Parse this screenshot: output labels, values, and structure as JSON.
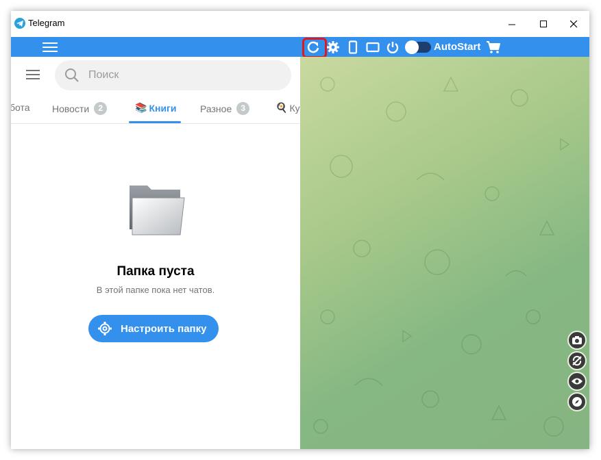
{
  "window": {
    "title": "Telegram"
  },
  "toolbar": {
    "autostart_label": "AutoStart",
    "icons": [
      "refresh-icon",
      "gear-icon",
      "phone-icon",
      "tablet-icon",
      "power-icon",
      "toggle",
      "cart-icon"
    ],
    "highlight_color": "#e0191c",
    "bar_color": "#3390ec"
  },
  "search": {
    "placeholder": "Поиск"
  },
  "tabs": [
    {
      "label": "бота"
    },
    {
      "label": "Новости",
      "badge": "2"
    },
    {
      "label": "Книги",
      "emoji": "📚",
      "active": true
    },
    {
      "label": "Разное",
      "badge": "3"
    },
    {
      "label": "Ку",
      "emoji": "🍳"
    }
  ],
  "empty": {
    "title": "Папка пуста",
    "subtitle": "В этой папке пока нет чатов.",
    "button": "Настроить папку"
  },
  "side_buttons": [
    "camera-icon",
    "no-rotate-icon",
    "eye-icon",
    "compass-icon"
  ],
  "colors": {
    "accent": "#3390ec",
    "badge": "#c4c9cc",
    "muted": "#707579"
  }
}
